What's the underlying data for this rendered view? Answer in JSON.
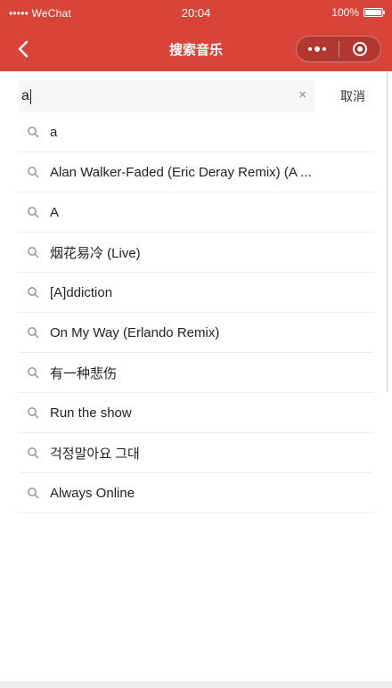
{
  "status_bar": {
    "carrier": "••••• WeChat",
    "wifi_icon": "wifi-icon",
    "time": "20:04",
    "battery": "100%"
  },
  "nav": {
    "title": "搜索音乐",
    "back_icon": "chevron-left-icon",
    "more_icon": "more-dots-icon",
    "close_icon": "target-icon"
  },
  "search": {
    "value": "a",
    "placeholder": "",
    "clear_label": "×",
    "cancel_label": "取消"
  },
  "suggestions": [
    "a",
    "Alan Walker-Faded (Eric Deray Remix)  (A ...",
    "A",
    "烟花易冷 (Live)",
    "[A]ddiction",
    "On My Way (Erlando Remix)",
    "有一种悲伤",
    "Run the show",
    "걱정말아요 그대",
    "Always Online"
  ],
  "colors": {
    "brand": "#d9443a"
  }
}
